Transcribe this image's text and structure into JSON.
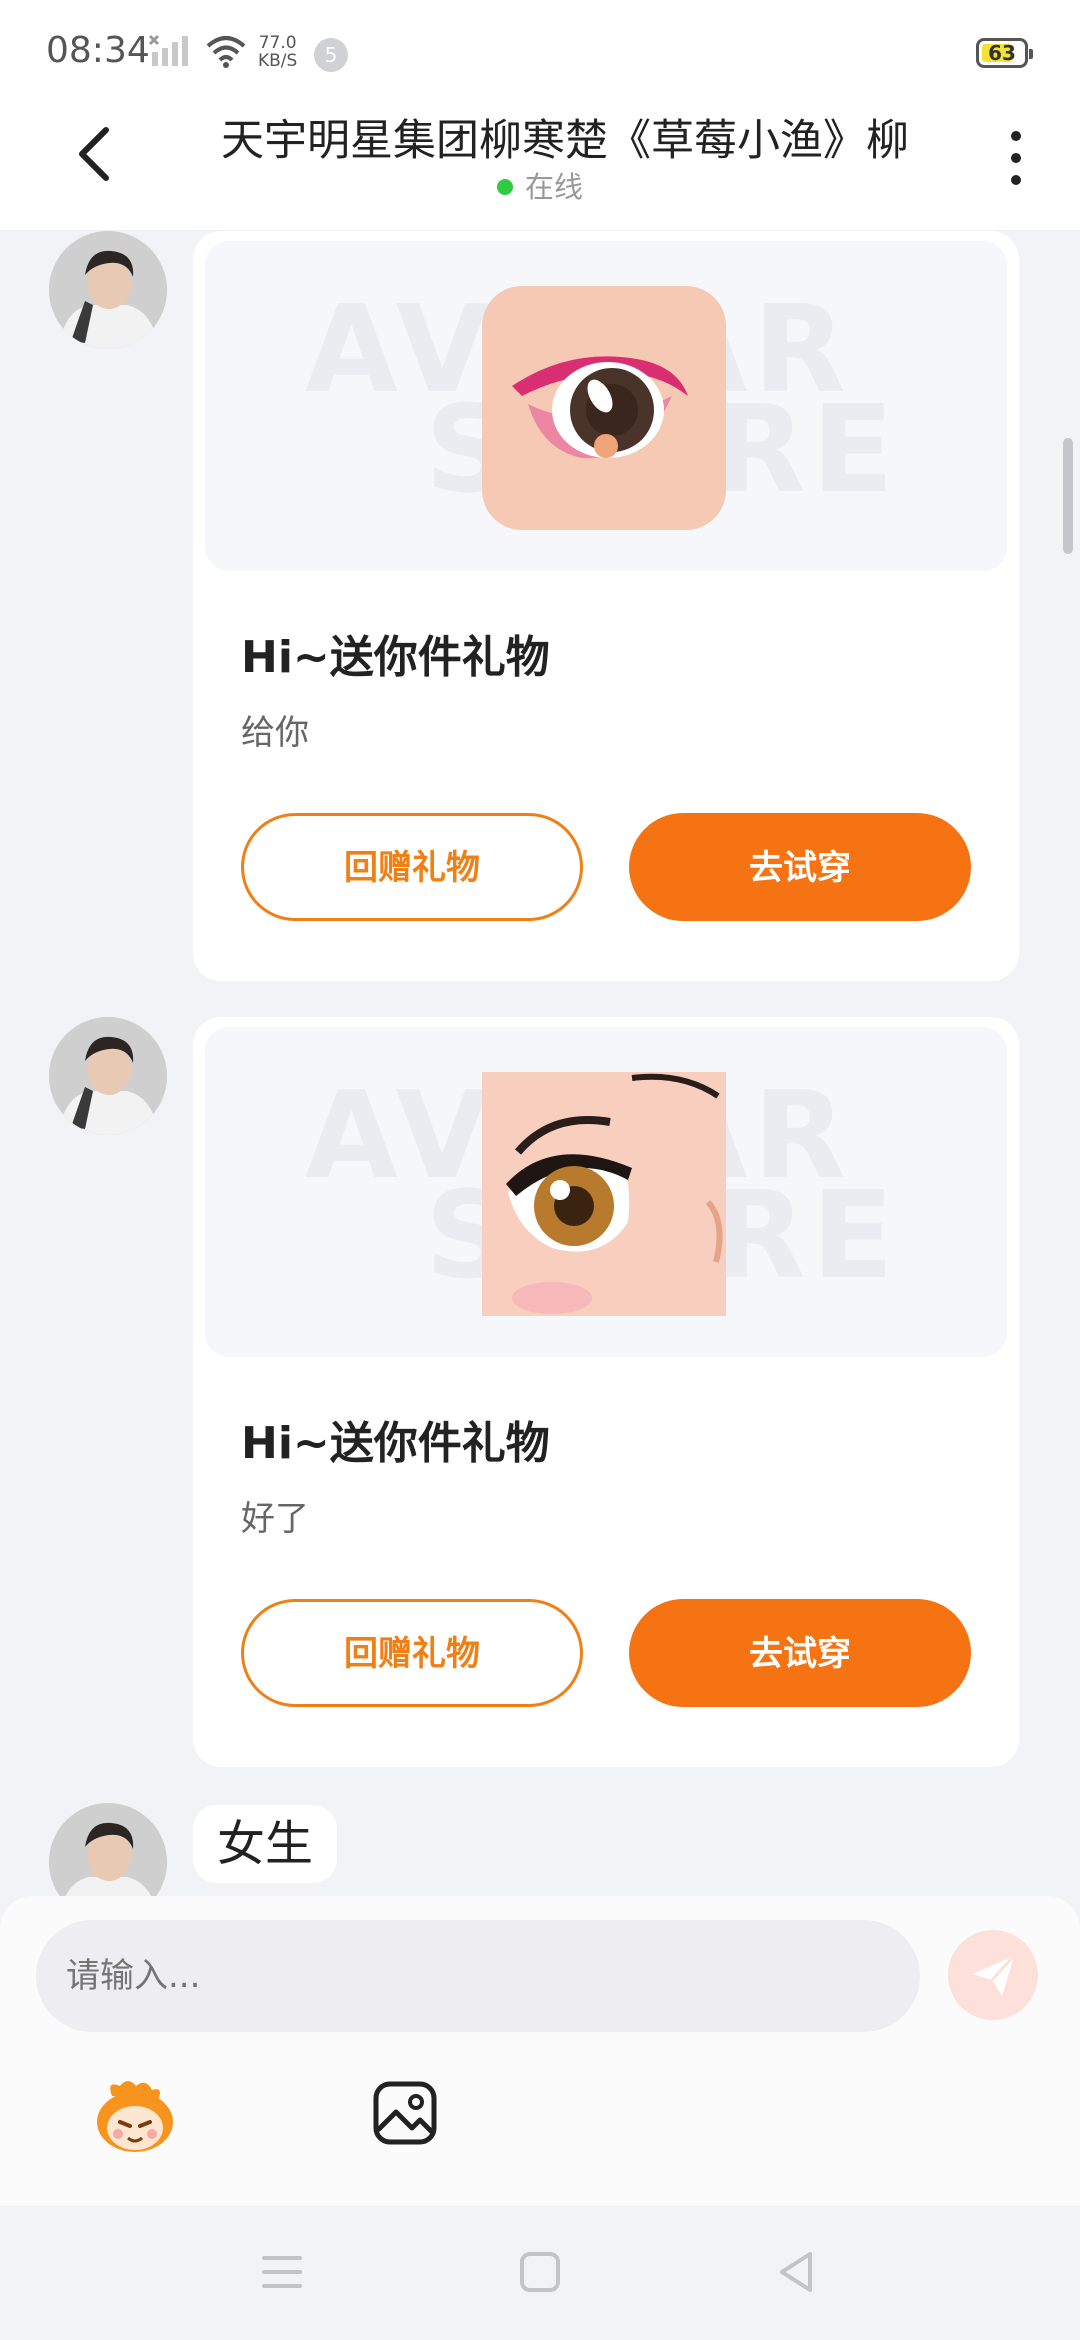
{
  "status_bar": {
    "time": "08:34",
    "speed_value": "77.0",
    "speed_unit": "KB/S",
    "notification_count": "5",
    "battery": "63"
  },
  "header": {
    "title": "天宇明星集团柳寒楚《草莓小渔》柳",
    "status": "在线"
  },
  "messages": [
    {
      "type": "gift",
      "title": "Hi~送你件礼物",
      "text": "给你",
      "return_button": "回赠礼物",
      "try_button": "去试穿",
      "watermark_line1": "AVATAR",
      "watermark_line2": "STORE"
    },
    {
      "type": "gift",
      "title": "Hi~送你件礼物",
      "text": "好了",
      "return_button": "回赠礼物",
      "try_button": "去试穿",
      "watermark_line1": "AVATAR",
      "watermark_line2": "STORE"
    },
    {
      "type": "text",
      "text": "女生"
    }
  ],
  "composer": {
    "placeholder": "请输入..."
  },
  "colors": {
    "accent": "#f57313",
    "online": "#2ecc40",
    "background": "#f2f3f7"
  },
  "icons": {
    "back": "chevron-left-icon",
    "more": "more-vertical-icon",
    "send": "send-icon",
    "mascot": "mascot-emoji-icon",
    "image": "image-icon"
  }
}
